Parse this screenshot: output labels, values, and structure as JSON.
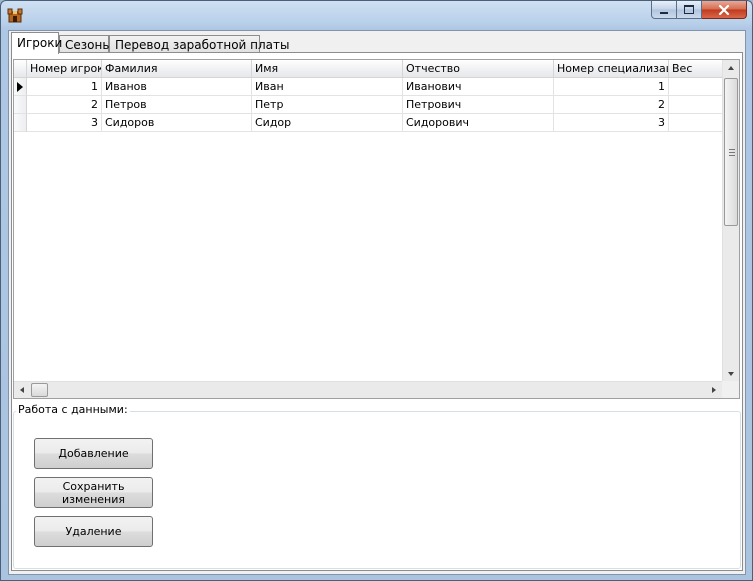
{
  "window": {
    "icon": "castle-icon",
    "controls": {
      "minimize": "minimize-icon",
      "maximize": "maximize-icon",
      "close": "close-icon"
    }
  },
  "tabs": [
    {
      "label": "Игроки",
      "active": true
    },
    {
      "label": "Сезоны",
      "active": false
    },
    {
      "label": "Перевод заработной платы",
      "active": false
    }
  ],
  "grid": {
    "columns": [
      "Номер игрока",
      "Фамилия",
      "Имя",
      "Отчество",
      "Номер специализации",
      "Вес"
    ],
    "rows": [
      {
        "player_number": "1",
        "last_name": "Иванов",
        "first_name": "Иван",
        "patronymic": "Иванович",
        "specialization": "1",
        "weight": ""
      },
      {
        "player_number": "2",
        "last_name": "Петров",
        "first_name": "Петр",
        "patronymic": "Петрович",
        "specialization": "2",
        "weight": ""
      },
      {
        "player_number": "3",
        "last_name": "Сидоров",
        "first_name": "Сидор",
        "patronymic": "Сидорович",
        "specialization": "3",
        "weight": ""
      }
    ]
  },
  "data_group": {
    "title": "Работа с данными:",
    "buttons": {
      "add": "Добавление",
      "save": "Сохранить изменения",
      "delete": "Удаление"
    }
  }
}
